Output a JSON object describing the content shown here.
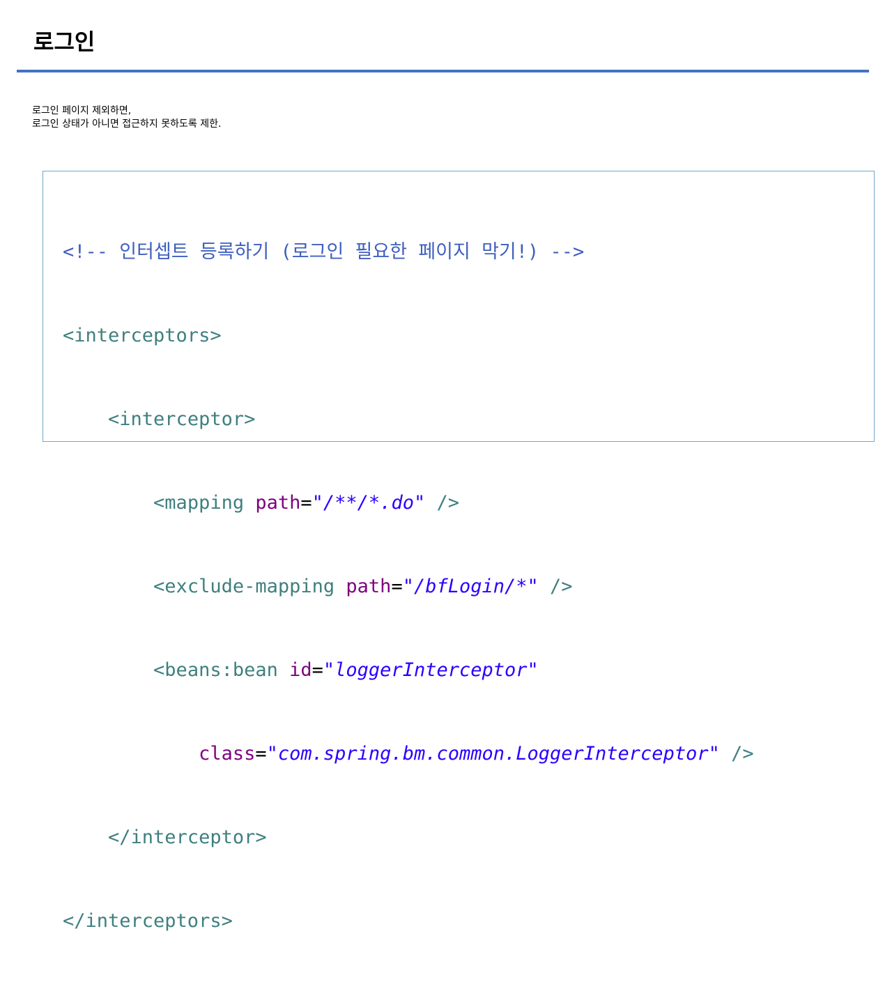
{
  "slide": {
    "title": "로그인",
    "body_lines": [
      "로그인 페이지 제외하면,",
      "로그인 상태가 아니면 접근하지 못하도록 제한."
    ]
  },
  "code": {
    "comment": "<!-- 인터셉트 등록하기 (로그인 필요한 페이지 막기!) -->",
    "interceptors_open": "<interceptors>",
    "interceptor_open": "<interceptor>",
    "mapping_tag": "<mapping",
    "mapping_attr": "path",
    "mapping_value": "\"/**/*.do\"",
    "mapping_close": " />",
    "exclude_tag": "<exclude-mapping",
    "exclude_attr": "path",
    "exclude_value": "\"/bfLogin/*\"",
    "exclude_close": " />",
    "bean_tag": "<beans:bean",
    "bean_id_attr": "id",
    "bean_id_value": "\"loggerInterceptor\"",
    "bean_class_attr": "class",
    "bean_class_value": "\"com.spring.bm.common.LoggerInterceptor\"",
    "bean_close": " />",
    "interceptor_close": "</interceptor>",
    "interceptors_close": "</interceptors>",
    "equals": "="
  },
  "colors": {
    "title_rule": "#4472c4",
    "comment": "#3f5fbf",
    "tag": "#3f7f7f",
    "attribute": "#7f007f",
    "value": "#2a00ff"
  }
}
